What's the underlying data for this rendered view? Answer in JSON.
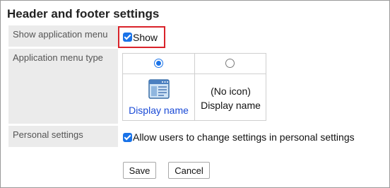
{
  "page": {
    "title": "Header and footer settings"
  },
  "settings": {
    "show_application_menu": {
      "label": "Show application menu",
      "checkbox_label": "Show",
      "checked": true
    },
    "application_menu_type": {
      "label": "Application menu type",
      "options": [
        {
          "id": "icon",
          "selected": true,
          "icon": "app-window-icon",
          "caption": "Display name"
        },
        {
          "id": "no-icon",
          "selected": false,
          "no_icon_text": "(No icon)",
          "caption": "Display name"
        }
      ]
    },
    "personal_settings": {
      "label": "Personal settings",
      "checkbox_label": "Allow users to change settings in personal settings",
      "checked": true
    }
  },
  "actions": {
    "save_label": "Save",
    "cancel_label": "Cancel"
  },
  "colors": {
    "highlight": "#d9232a",
    "accent": "#1a73e8",
    "link": "#1a4ad6",
    "label_bg": "#ebebeb"
  }
}
